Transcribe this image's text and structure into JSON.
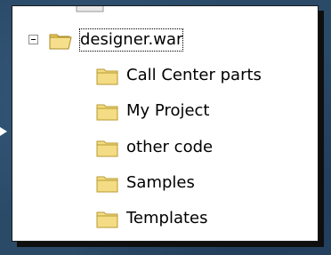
{
  "tree": {
    "root": {
      "label": "designer.war",
      "expanded": true,
      "selected": true,
      "expander_icon": "collapse-minus-icon",
      "icon": "folder-open-icon"
    },
    "children": [
      {
        "label": "Call Center parts",
        "icon": "folder-icon"
      },
      {
        "label": "My Project",
        "icon": "folder-icon"
      },
      {
        "label": "other code",
        "icon": "folder-icon"
      },
      {
        "label": "Samples",
        "icon": "folder-icon"
      },
      {
        "label": "Templates",
        "icon": "folder-icon"
      }
    ]
  },
  "colors": {
    "background": "#2a4a68",
    "folder_fill": "#f4dc84",
    "folder_edge": "#b89a30",
    "panel": "#ffffff"
  }
}
